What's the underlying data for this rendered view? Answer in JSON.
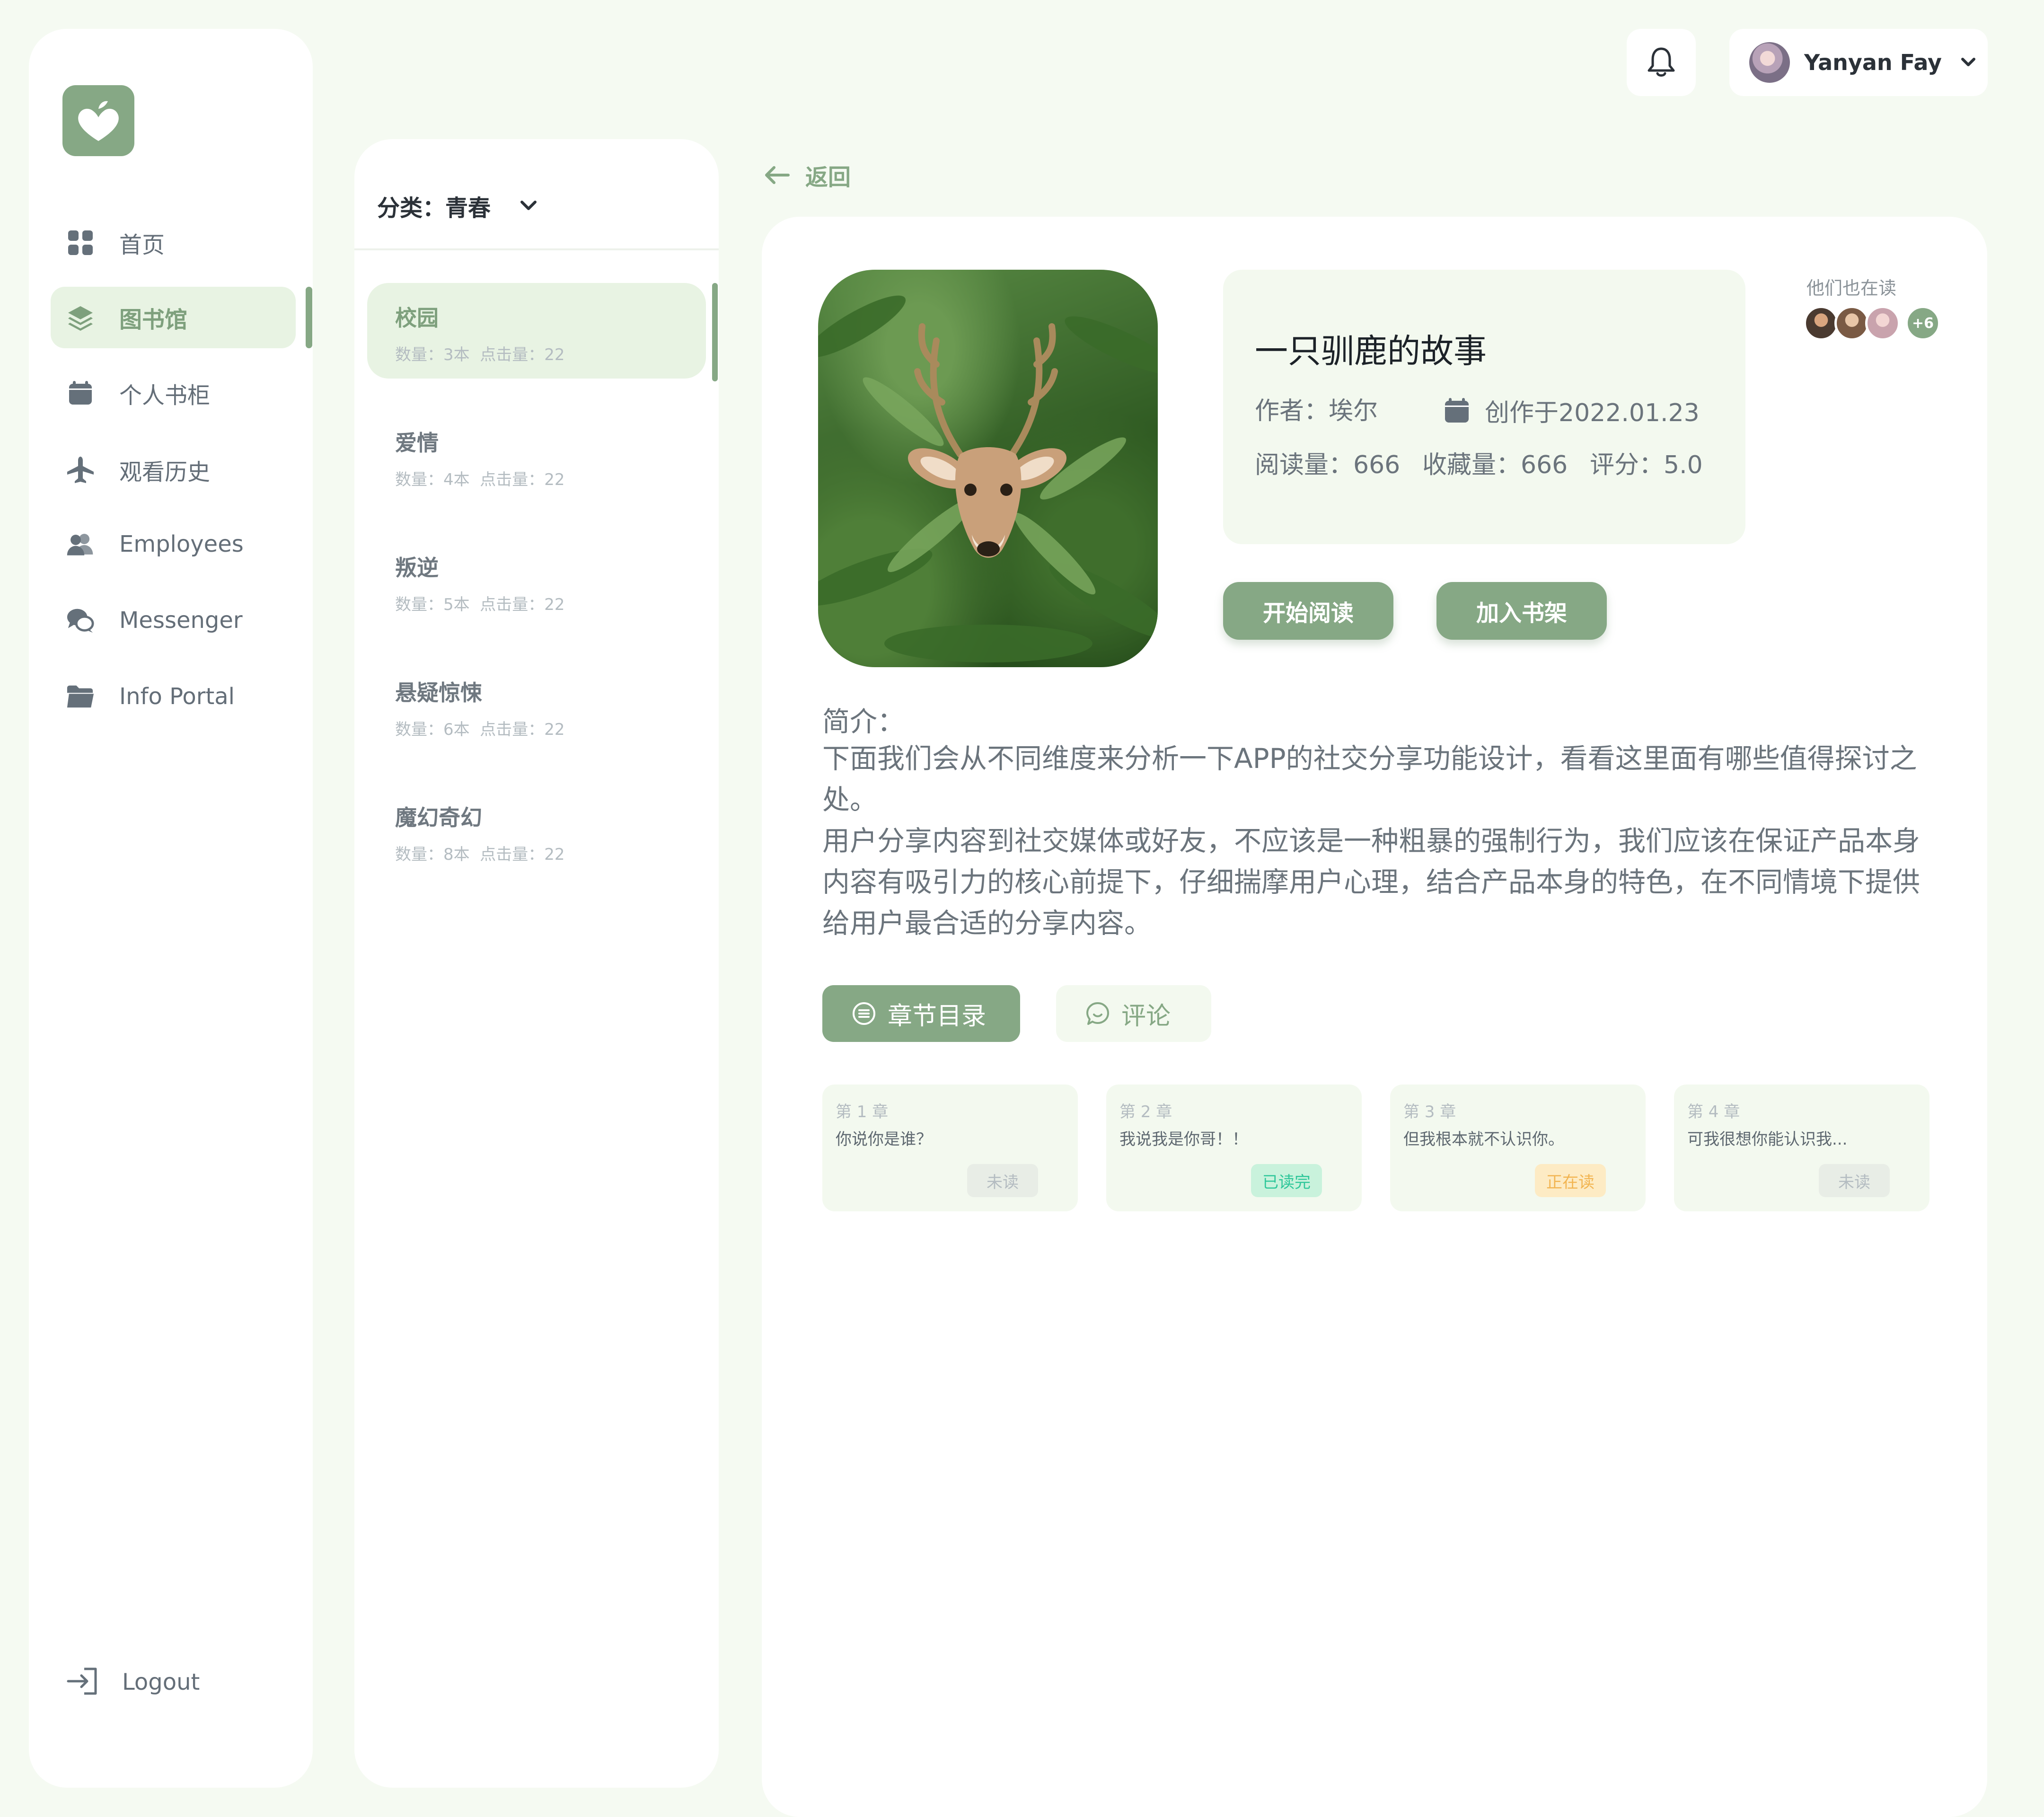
{
  "sidebar": {
    "items": [
      {
        "label": "首页",
        "icon": "grid-icon"
      },
      {
        "label": "图书馆",
        "icon": "layers-icon",
        "active": true
      },
      {
        "label": "个人书柜",
        "icon": "calendar-icon"
      },
      {
        "label": "观看历史",
        "icon": "airplane-icon"
      },
      {
        "label": "Employees",
        "icon": "users-icon"
      },
      {
        "label": "Messenger",
        "icon": "chat-icon"
      },
      {
        "label": "Info Portal",
        "icon": "folder-icon"
      }
    ],
    "logout_label": "Logout"
  },
  "categories": {
    "header_label": "分类：青春",
    "items": [
      {
        "name": "校园",
        "count": "数量：3本",
        "clicks": "点击量：22",
        "active": true
      },
      {
        "name": "爱情",
        "count": "数量：4本",
        "clicks": "点击量：22"
      },
      {
        "name": "叛逆",
        "count": "数量：5本",
        "clicks": "点击量：22"
      },
      {
        "name": "悬疑惊悚",
        "count": "数量：6本",
        "clicks": "点击量：22"
      },
      {
        "name": "魔幻奇幻",
        "count": "数量：8本",
        "clicks": "点击量：22"
      }
    ]
  },
  "header": {
    "user_name": "Yanyan Fay"
  },
  "back_label": "返回",
  "book": {
    "title": "一只驯鹿的故事",
    "author": "作者：埃尔",
    "created": "创作于2022.01.23",
    "reads": "阅读量：666",
    "favorites": "收藏量：666",
    "rating": "评分：5.0",
    "readers_label": "他们也在读",
    "readers_more": "+6",
    "start_reading_label": "开始阅读",
    "add_shelf_label": "加入书架",
    "description_heading": "简介：",
    "description_paragraphs": [
      "下面我们会从不同维度来分析一下APP的社交分享功能设计，看看这里面有哪些值得探讨之处。",
      "用户分享内容到社交媒体或好友，不应该是一种粗暴的强制行为，我们应该在保证产品本身内容有吸引力的核心前提下，仔细揣摩用户心理，结合产品本身的特色，在不同情境下提供给用户最合适的分享内容。"
    ]
  },
  "tabs": [
    {
      "label": "章节目录",
      "active": true
    },
    {
      "label": "评论",
      "active": false
    }
  ],
  "chapters": [
    {
      "num": "第 1 章",
      "title": "你说你是谁？",
      "status": "未读",
      "status_color": "#b4bcc1",
      "status_bg": "#e8ede6"
    },
    {
      "num": "第 2 章",
      "title": "我说我是你哥！！",
      "status": "已读完",
      "status_color": "#2fc79a",
      "status_bg": "#c9f2dc"
    },
    {
      "num": "第 3 章",
      "title": "但我根本就不认识你。",
      "status": "正在读",
      "status_color": "#f2b552",
      "status_bg": "#fdebc4"
    },
    {
      "num": "第 4 章",
      "title": "可我很想你能认识我...",
      "status": "未读",
      "status_color": "#b4bcc1",
      "status_bg": "#e8ede6"
    }
  ],
  "colors": {
    "accent": "#86a885",
    "accent_light": "#e8f3e3",
    "panel_bg": "#f3f9ef",
    "page_bg": "#f5faf2"
  }
}
